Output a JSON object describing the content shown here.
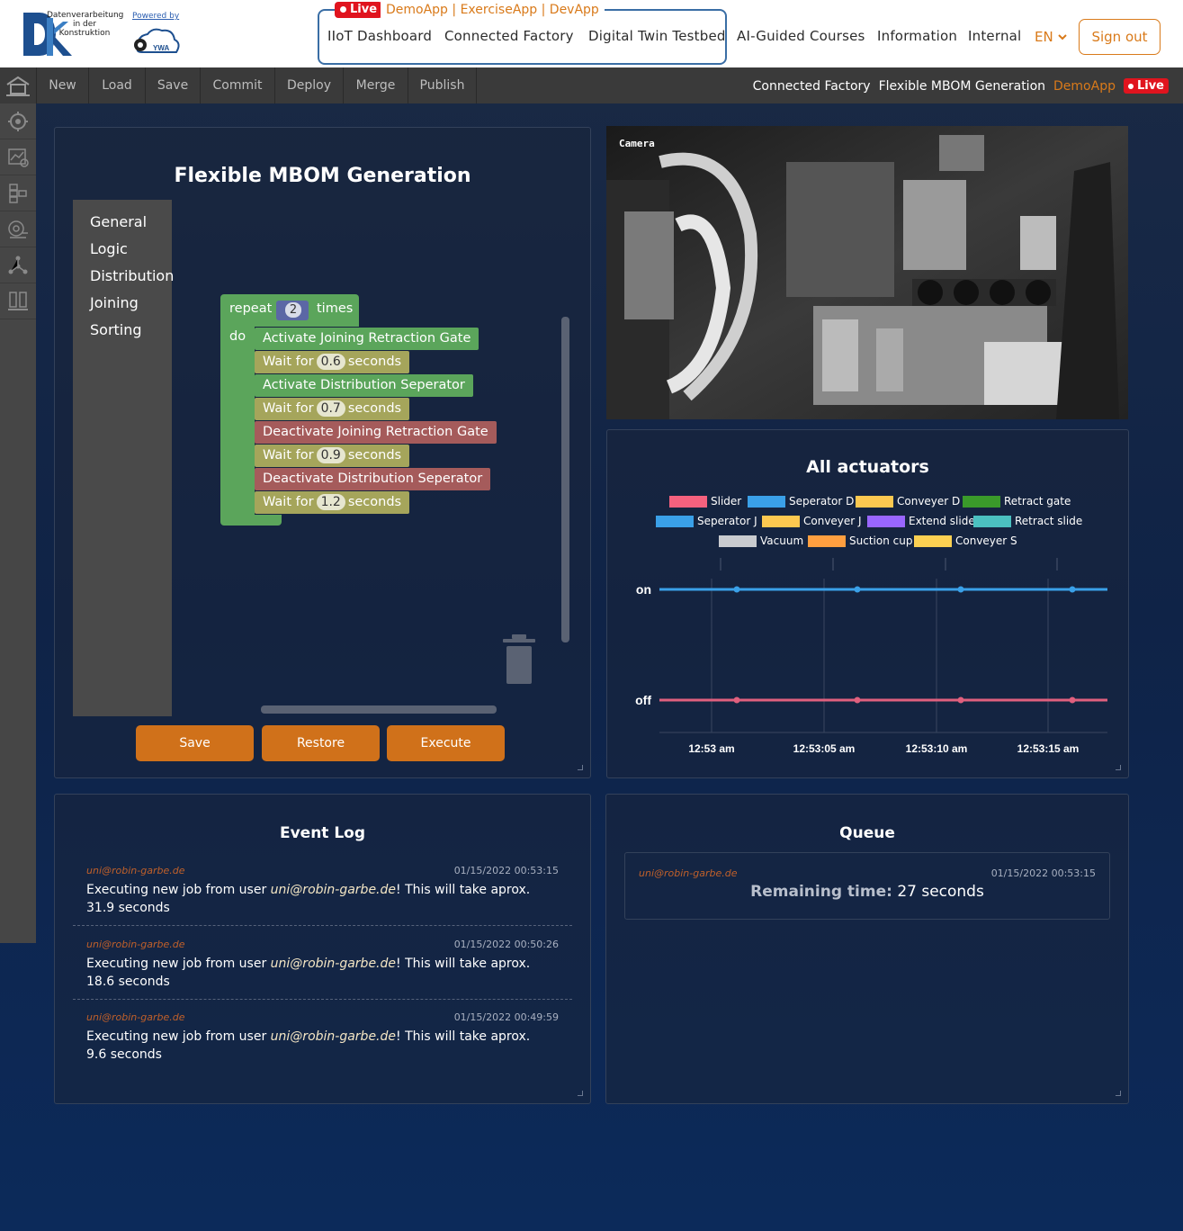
{
  "header": {
    "logo_text": "Datenverarbeitung in der Konstruktion",
    "powered_by": "Powered by",
    "ywa_text": "YWA",
    "live_label": "Live",
    "apps": "DemoApp | ExerciseApp | DevApp",
    "nav": [
      {
        "label": "IIoT Dashboard"
      },
      {
        "label": "Connected Factory"
      },
      {
        "label": "Digital Twin Testbed"
      },
      {
        "label": "AI-Guided Courses"
      },
      {
        "label": "Information"
      },
      {
        "label": "Internal"
      }
    ],
    "language": "EN",
    "sign_out": "Sign out"
  },
  "toolbar": {
    "buttons": [
      "New",
      "Load",
      "Save",
      "Commit",
      "Deploy",
      "Merge",
      "Publish"
    ],
    "breadcrumb": [
      "Connected Factory",
      "Flexible MBOM Generation"
    ],
    "app_name": "DemoApp",
    "live_label": "Live"
  },
  "sidebar": {
    "icons": [
      "home-icon",
      "settings-cog-icon",
      "analytics-icon",
      "modules-icon",
      "data-gear-icon",
      "network-icon",
      "server-icon"
    ]
  },
  "editor": {
    "title": "Flexible MBOM Generation",
    "categories": [
      "General",
      "Logic",
      "Distribution",
      "Joining",
      "Sorting"
    ],
    "repeat": {
      "label": "repeat",
      "count": "2",
      "times": "times",
      "do": "do"
    },
    "blocks": [
      {
        "type": "green",
        "text": "Activate Joining Retraction Gate"
      },
      {
        "type": "wait",
        "pre": "Wait for",
        "value": "0.6",
        "post": "seconds"
      },
      {
        "type": "green",
        "text": "Activate Distribution Seperator"
      },
      {
        "type": "wait",
        "pre": "Wait for",
        "value": "0.7",
        "post": "seconds"
      },
      {
        "type": "red",
        "text": "Deactivate Joining Retraction Gate"
      },
      {
        "type": "wait",
        "pre": "Wait for",
        "value": "0.9",
        "post": "seconds"
      },
      {
        "type": "red",
        "text": "Deactivate Distribution Seperator"
      },
      {
        "type": "wait",
        "pre": "Wait for",
        "value": "1.2",
        "post": "seconds"
      }
    ],
    "buttons": {
      "save": "Save",
      "restore": "Restore",
      "execute": "Execute"
    }
  },
  "camera": {
    "label": "Camera"
  },
  "chart_data": {
    "type": "line",
    "title": "All actuators",
    "legend": [
      {
        "name": "Slider",
        "color": "#f5617e"
      },
      {
        "name": "Seperator D",
        "color": "#3aa0e8"
      },
      {
        "name": "Conveyer D",
        "color": "#fcc850"
      },
      {
        "name": "Retract gate",
        "color": "#3a9a2a"
      },
      {
        "name": "Seperator J",
        "color": "#3aa0e8"
      },
      {
        "name": "Conveyer J",
        "color": "#fcc850"
      },
      {
        "name": "Extend slide",
        "color": "#9966ff"
      },
      {
        "name": "Retract slide",
        "color": "#4bc0c0"
      },
      {
        "name": "Vacuum",
        "color": "#c9cbcf"
      },
      {
        "name": "Suction cup",
        "color": "#ff9f40"
      },
      {
        "name": "Conveyer S",
        "color": "#fcd052"
      }
    ],
    "y_categories": [
      "on",
      "off"
    ],
    "x_ticks": [
      "12:53 am",
      "12:53:05 am",
      "12:53:10 am",
      "12:53:15 am"
    ],
    "series": [
      {
        "name": "Seperator D",
        "color": "#3aa0e8",
        "values": [
          "on",
          "on",
          "on",
          "on"
        ]
      },
      {
        "name": "Slider",
        "color": "#e0607e",
        "values": [
          "off",
          "off",
          "off",
          "off"
        ]
      }
    ]
  },
  "event_log": {
    "title": "Event Log",
    "entries": [
      {
        "user": "uni@robin-garbe.de",
        "time": "01/15/2022 00:53:15",
        "pre": "Executing new job from user ",
        "email": "uni@robin-garbe.de",
        "post": "! This will take aprox. 31.9 seconds"
      },
      {
        "user": "uni@robin-garbe.de",
        "time": "01/15/2022 00:50:26",
        "pre": "Executing new job from user ",
        "email": "uni@robin-garbe.de",
        "post": "! This will take aprox. 18.6 seconds"
      },
      {
        "user": "uni@robin-garbe.de",
        "time": "01/15/2022 00:49:59",
        "pre": "Executing new job from user ",
        "email": "uni@robin-garbe.de",
        "post": "! This will take aprox. 9.6 seconds"
      }
    ]
  },
  "queue": {
    "title": "Queue",
    "user": "uni@robin-garbe.de",
    "time": "01/15/2022 00:53:15",
    "remaining_label": "Remaining time:",
    "remaining_value": "27 seconds"
  }
}
